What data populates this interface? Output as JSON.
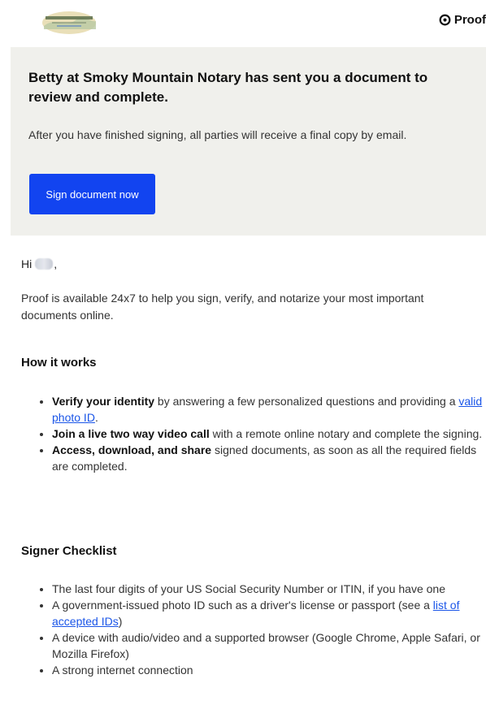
{
  "header": {
    "brand_name": "Proof"
  },
  "hero": {
    "title": "Betty at Smoky Mountain Notary has sent you a document to review and complete.",
    "subtitle": "After you have finished signing, all parties will receive a final copy by email.",
    "cta_label": "Sign document now"
  },
  "body": {
    "greeting_prefix": "Hi",
    "greeting_suffix": ",",
    "intro": "Proof is available 24x7 to help you sign, verify, and notarize your most important documents online."
  },
  "how_it_works": {
    "heading": "How it works",
    "items": [
      {
        "bold": "Verify your identity",
        "text": " by answering a few personalized questions and providing a ",
        "link": "valid photo ID",
        "after": "."
      },
      {
        "bold": "Join a live two way video call",
        "text": " with a remote online notary and complete the signing."
      },
      {
        "bold": "Access, download, and share",
        "text": " signed documents, as soon as all the required fields are completed."
      }
    ]
  },
  "checklist": {
    "heading": "Signer Checklist",
    "items": [
      {
        "text": "The last four digits of your US Social Security Number or ITIN, if you have one"
      },
      {
        "text": "A government-issued photo ID such as a driver's license or passport (see a ",
        "link": "list of accepted IDs",
        "after": ")"
      },
      {
        "text": "A device with audio/video and a supported browser (Google Chrome, Apple Safari, or Mozilla Firefox)"
      },
      {
        "text": "A strong internet connection"
      }
    ]
  }
}
